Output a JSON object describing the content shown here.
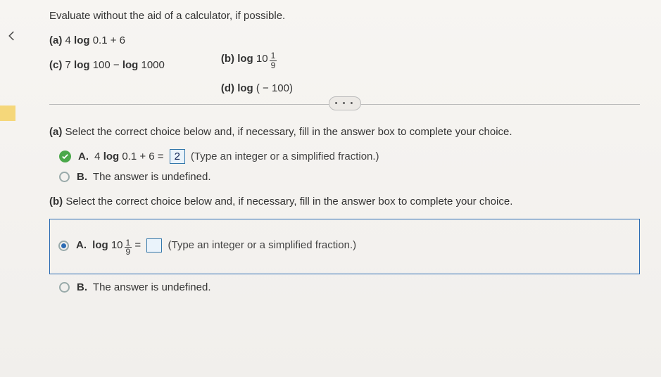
{
  "header": {
    "prompt": "Evaluate without the aid of a calculator, if possible."
  },
  "problems": {
    "a_label": "(a)",
    "a_expr_prefix": "4 ",
    "a_expr_log": "log",
    "a_expr_rest": " 0.1 + 6",
    "b_label": "(b)",
    "b_expr_log": "log",
    "b_expr_base": " 10",
    "b_frac_num": "1",
    "b_frac_den": "9",
    "c_label": "(c)",
    "c_expr_prefix": "7 ",
    "c_log1": "log",
    "c_mid": " 100 − ",
    "c_log2": "log",
    "c_tail": " 1000",
    "d_label": "(d)",
    "d_log": "log",
    "d_arg": " ( − 100)"
  },
  "partA": {
    "intro_label": "(a)",
    "intro_text": " Select the correct choice below and, if necessary, fill in the answer box to complete your choice.",
    "optA_letter": "A.",
    "optA_prefix": "4 ",
    "optA_log": "log",
    "optA_eq": " 0.1 + 6 = ",
    "optA_value": "2",
    "optA_hint": "  (Type an integer or a simplified fraction.)",
    "optB_letter": "B.",
    "optB_text": "The answer is undefined."
  },
  "partB": {
    "intro_label": "(b)",
    "intro_text": " Select the correct choice below and, if necessary, fill in the answer box to complete your choice.",
    "optA_letter": "A.",
    "optA_log": "log",
    "optA_base": " 10",
    "optA_frac_num": "1",
    "optA_frac_den": "9",
    "optA_eq": " = ",
    "optA_hint": " (Type an integer or a simplified fraction.)",
    "optB_letter": "B.",
    "optB_text": "The answer is undefined."
  },
  "ellipsis": "• • •"
}
